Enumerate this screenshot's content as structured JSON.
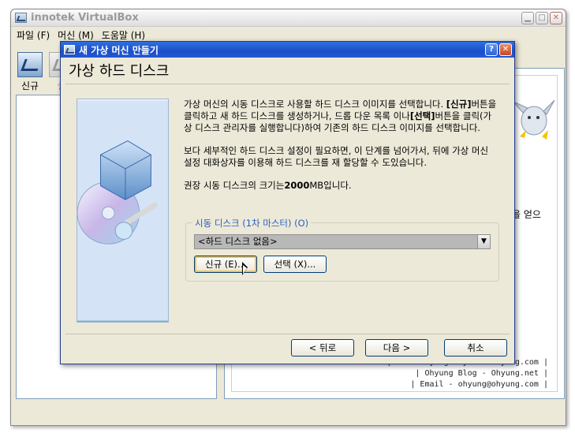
{
  "main_window": {
    "title": "innotek VirtualBox",
    "menu": [
      "파일 (F)",
      "머신 (M)",
      "도움말 (H)"
    ],
    "toolbar": [
      {
        "label": "신규",
        "icon": "new-vm-icon"
      },
      {
        "label": "설",
        "icon": "settings-icon"
      }
    ],
    "welcome_fragment": "을 얻으",
    "watermark": [
      "| It's Ohyung Style - Ohyung.com |",
      "| Ohyung Blog - Ohyung.net |",
      "| Email - ohyung@ohyung.com |"
    ]
  },
  "dialog": {
    "title": "새 가상 머신 만들기",
    "help_button": "?",
    "close_button": "✕",
    "page_title": "가상 하드 디스크",
    "paragraph1_pre": "가상 머신의 시동 디스크로 사용할 하드 디스크 이미지를 선택합니다.",
    "paragraph1_new_bold": "[신규]",
    "paragraph1_mid": "버튼을 클릭하고 새 하드 디스크를 생성하거나, 드롭 다운 목록 이나",
    "paragraph1_select_bold": "[선택]",
    "paragraph1_post": "버튼을 클릭(가상 디스크 관리자를 실행합니다)하여 기존의 하드 디스크 이미지를 선택합니다.",
    "paragraph2": "보다 세부적인 하드 디스크 설정이 필요하면, 이 단계를 넘어가서, 뒤에 가상 머신 설정 대화상자를 이용해 하드 디스크를 재 할당할 수 도있습니다.",
    "paragraph3_pre": "권장 시동 디스크의 크기는",
    "paragraph3_value": "2000",
    "paragraph3_post": "MB입니다.",
    "boot_disk_group_label": "시동 디스크 (1차 마스터) (O)",
    "boot_disk_selected": "<하드 디스크 없음>",
    "new_button": "신규 (E)...",
    "select_button": "선택 (X)...",
    "back_button": "< 뒤로",
    "next_button": "다음 >",
    "cancel_button": "취소"
  }
}
